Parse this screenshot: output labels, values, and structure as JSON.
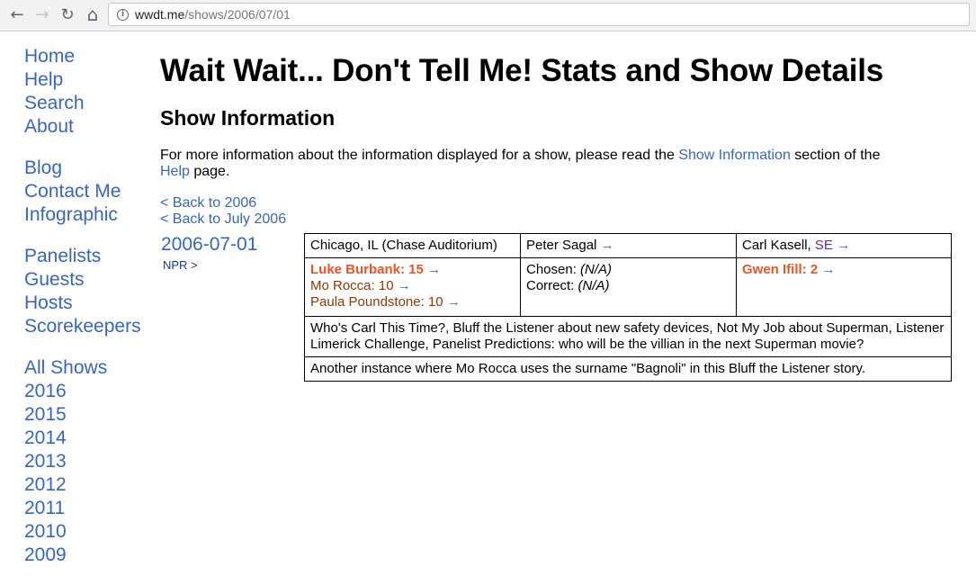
{
  "browser": {
    "url_host": "wwdt.me",
    "url_path": "/shows/2006/07/01"
  },
  "sidebar": {
    "group1": [
      "Home",
      "Help",
      "Search",
      "About"
    ],
    "group2": [
      "Blog",
      "Contact Me",
      "Infographic"
    ],
    "group3": [
      "Panelists",
      "Guests",
      "Hosts",
      "Scorekeepers"
    ],
    "group4": [
      "All Shows",
      "2016",
      "2015",
      "2014",
      "2013",
      "2012",
      "2011",
      "2010",
      "2009"
    ]
  },
  "page": {
    "title": "Wait Wait... Don't Tell Me! Stats and Show Details",
    "section_title": "Show Information",
    "intro_before": "For more information about the information displayed for a show, please read the ",
    "intro_link1": "Show Information",
    "intro_middle": " section of the ",
    "intro_link2": "Help",
    "intro_after": " page.",
    "back_year": "< Back to 2006",
    "back_month": "< Back to July 2006"
  },
  "show": {
    "date": "2006-07-01",
    "npr_link": "NPR >",
    "location": "Chicago, IL (Chase Auditorium)",
    "host": "Peter Sagal",
    "scorekeeper": "Carl Kasell",
    "scorekeeper_badge": "SE",
    "arrow": "→",
    "panelists": [
      {
        "name_score": "Luke Burbank: 15"
      },
      {
        "name_score": "Mo Rocca: 10"
      },
      {
        "name_score": "Paula Poundstone: 10"
      }
    ],
    "chosen_label": "Chosen: ",
    "chosen_value": "(N/A)",
    "correct_label": "Correct: ",
    "correct_value": "(N/A)",
    "guest": "Gwen Ifill: 2",
    "description": "Who's Carl This Time?, Bluff the Listener about new safety devices, Not My Job about Superman, Listener Limerick Challenge, Panelist Predictions: who will be the villian in the next Superman movie?",
    "notes": "Another instance where Mo Rocca uses the surname \"Bagnoli\" in this Bluff the Listener story."
  },
  "icons": {
    "back": "←",
    "forward": "→",
    "reload": "↻",
    "home": "⌂",
    "info": "i"
  }
}
